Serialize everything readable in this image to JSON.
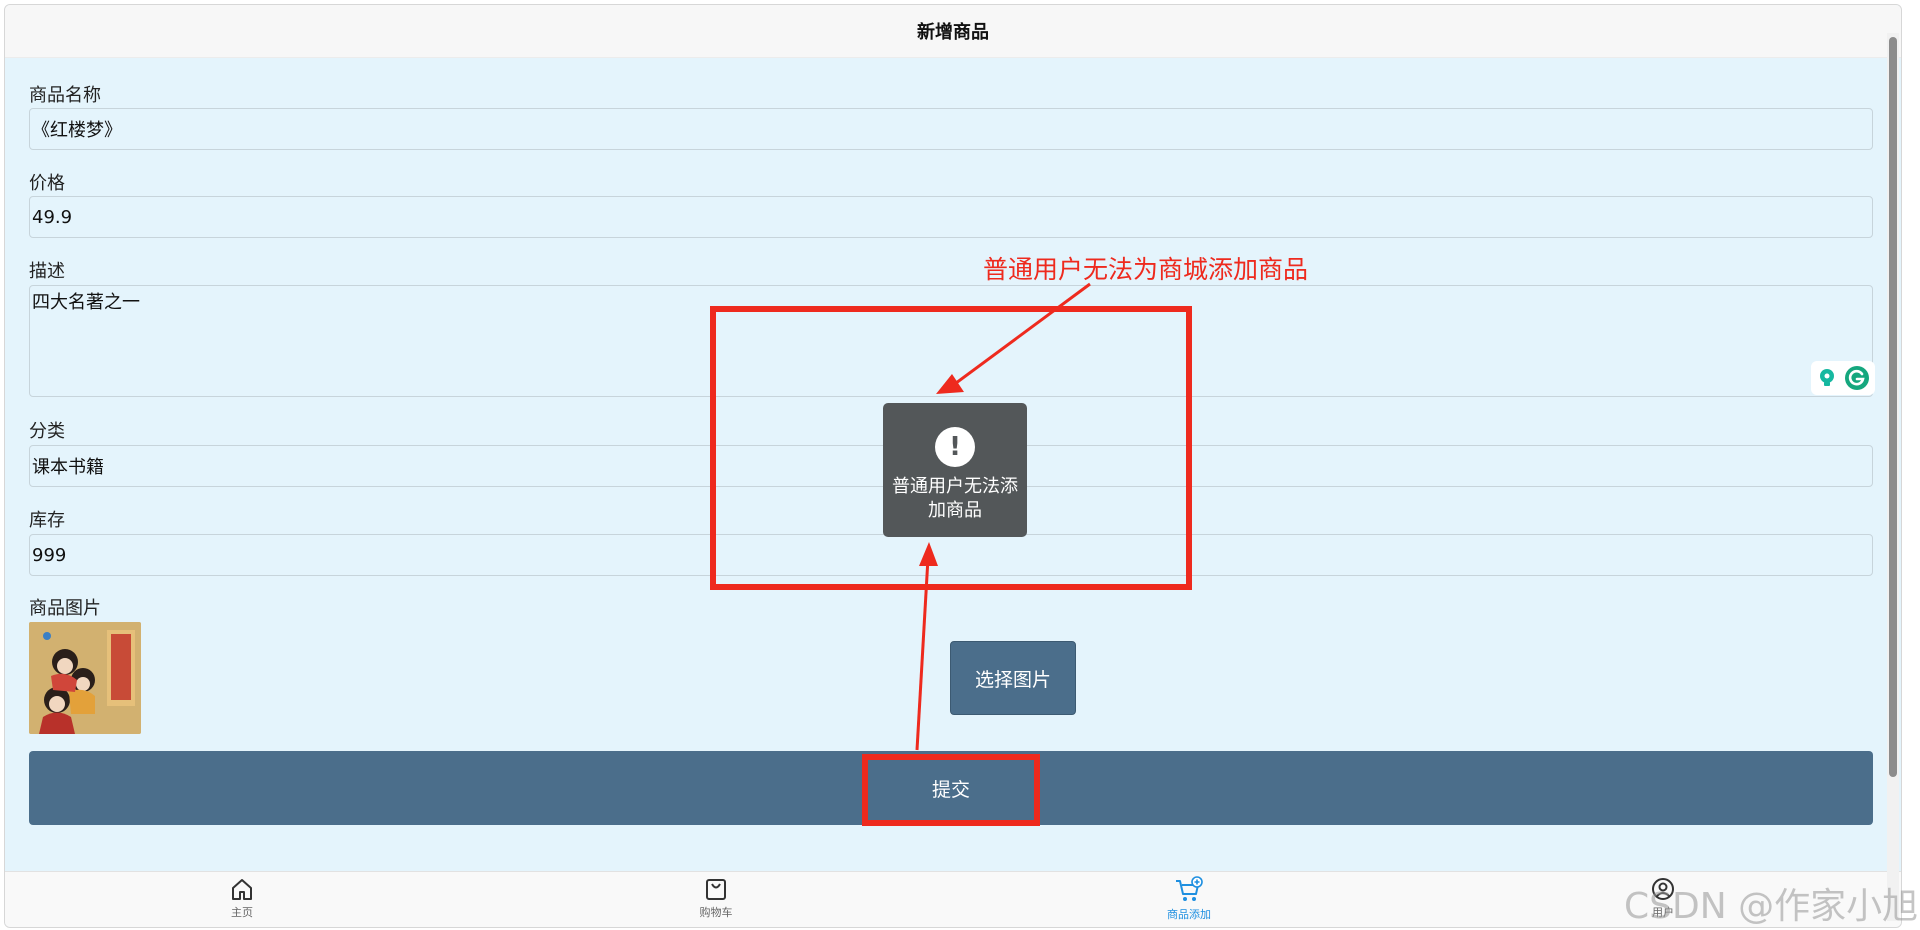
{
  "header": {
    "title": "新增商品"
  },
  "form": {
    "name_label": "商品名称",
    "name_value": "《红楼梦》",
    "price_label": "价格",
    "price_value": "49.9",
    "desc_label": "描述",
    "desc_value": "四大名著之一",
    "category_label": "分类",
    "category_value": "课本书籍",
    "stock_label": "库存",
    "stock_value": "999",
    "image_label": "商品图片",
    "choose_image_label": "选择图片",
    "submit_label": "提交"
  },
  "toast": {
    "message": "普通用户无法添加商品"
  },
  "annotation": {
    "text": "普通用户无法为商城添加商品"
  },
  "tabbar": {
    "items": [
      {
        "label": "主页",
        "icon": "home-icon"
      },
      {
        "label": "购物车",
        "icon": "shopping-bag-icon"
      },
      {
        "label": "商品添加",
        "icon": "cart-add-icon",
        "active": true
      },
      {
        "label": "用户",
        "icon": "user-icon"
      }
    ]
  },
  "watermark": {
    "text": "CSDN @作家小旭"
  },
  "colors": {
    "background": "#e4f4fc",
    "button": "#4b6e8b",
    "annotation": "#ee2a1e",
    "active_tab": "#1e8fe0",
    "toast": "#535759"
  }
}
